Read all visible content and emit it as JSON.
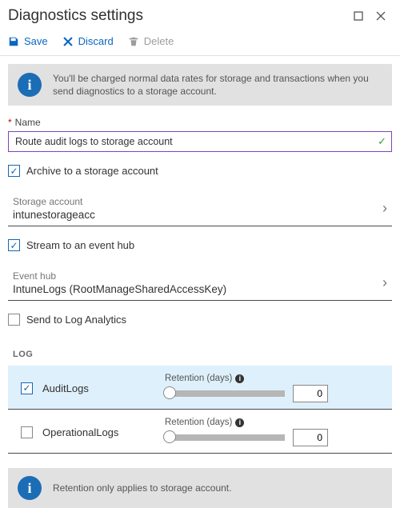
{
  "header": {
    "title": "Diagnostics settings"
  },
  "toolbar": {
    "save": "Save",
    "discard": "Discard",
    "delete": "Delete"
  },
  "info1": "You'll be charged normal data rates for storage and transactions when you send diagnostics to a storage account.",
  "name": {
    "label": "Name",
    "value": "Route audit logs to storage account"
  },
  "options": {
    "archive": {
      "label": "Archive to a storage account",
      "checked": true
    },
    "stream": {
      "label": "Stream to an event hub",
      "checked": true
    },
    "logan": {
      "label": "Send to Log Analytics",
      "checked": false
    }
  },
  "storage": {
    "label": "Storage account",
    "value": "intunestorageacc"
  },
  "eventhub": {
    "label": "Event hub",
    "value": "IntuneLogs (RootManageSharedAccessKey)"
  },
  "logSection": {
    "heading": "LOG",
    "retentionLabel": "Retention (days)",
    "rows": [
      {
        "name": "AuditLogs",
        "checked": true,
        "retention": "0"
      },
      {
        "name": "OperationalLogs",
        "checked": false,
        "retention": "0"
      }
    ]
  },
  "info2": "Retention only applies to storage account."
}
